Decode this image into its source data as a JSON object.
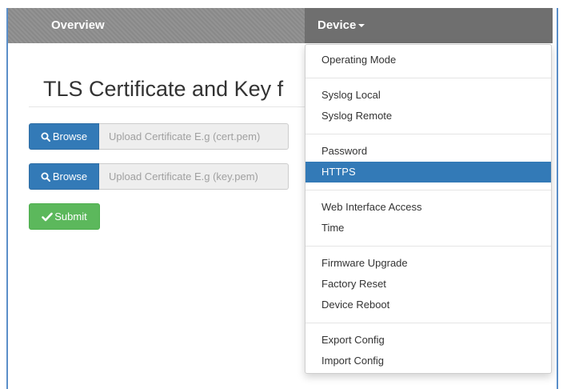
{
  "navbar": {
    "overview_label": "Overview",
    "device_label": "Device"
  },
  "page": {
    "title": "TLS Certificate and Key f"
  },
  "uploads": [
    {
      "button_label": "Browse",
      "placeholder": "Upload Certificate E.g (cert.pem)"
    },
    {
      "button_label": "Browse",
      "placeholder": "Upload Certificate E.g (key.pem)"
    }
  ],
  "submit_label": "Submit",
  "dropdown": {
    "items": [
      "Operating Mode",
      "Syslog Local",
      "Syslog Remote",
      "Password",
      "HTTPS",
      "Web Interface Access",
      "Time",
      "Firmware Upgrade",
      "Factory Reset",
      "Device Reboot",
      "Export Config",
      "Import Config"
    ],
    "active_item": "HTTPS"
  },
  "colors": {
    "navbar": "#8d8d8d",
    "navbar_active": "#6f6f6f",
    "primary": "#337ab7",
    "success": "#5cb85c",
    "frame_border": "#5b8fc9"
  },
  "icons": {
    "browse": "search-icon",
    "submit": "check-icon",
    "device_toggle": "caret-down-icon"
  }
}
